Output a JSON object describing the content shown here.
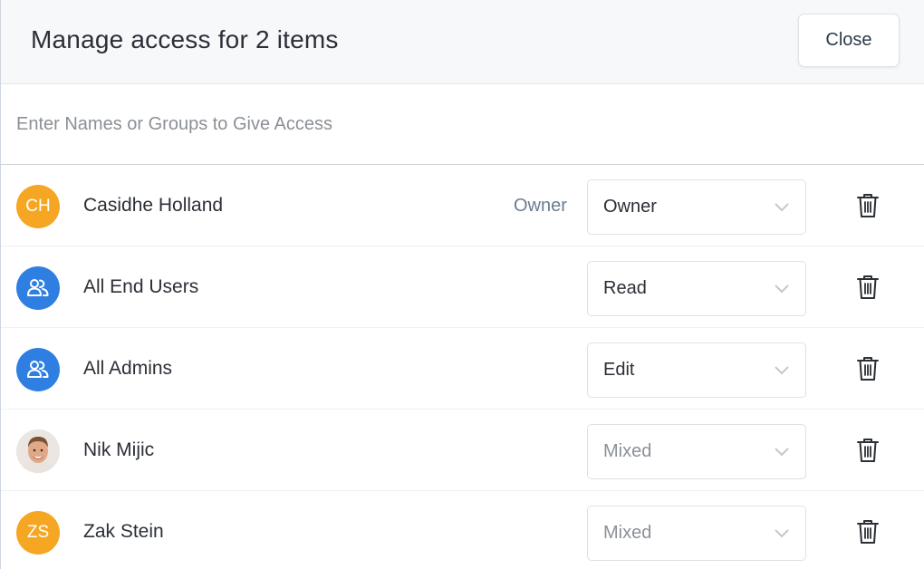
{
  "dialog": {
    "title": "Manage access for 2 items",
    "close_label": "Close"
  },
  "search": {
    "placeholder": "Enter Names or Groups to Give Access",
    "value": ""
  },
  "members": [
    {
      "name": "Casidhe Holland",
      "avatar_type": "initials",
      "initials": "CH",
      "owner_tag": "Owner",
      "permission": "Owner",
      "permission_muted": false
    },
    {
      "name": "All End Users",
      "avatar_type": "group",
      "avatar_icon": "group-icon",
      "permission": "Read",
      "permission_muted": false
    },
    {
      "name": "All Admins",
      "avatar_type": "group",
      "avatar_icon": "group-icon",
      "permission": "Edit",
      "permission_muted": false
    },
    {
      "name": "Nik Mijic",
      "avatar_type": "photo",
      "permission": "Mixed",
      "permission_muted": true
    },
    {
      "name": "Zak Stein",
      "avatar_type": "initials",
      "initials": "ZS",
      "permission": "Mixed",
      "permission_muted": true
    }
  ],
  "colors": {
    "initials_avatar": "#f5a623",
    "group_avatar": "#2f7fe3",
    "owner_tag": "#6b7d90"
  }
}
